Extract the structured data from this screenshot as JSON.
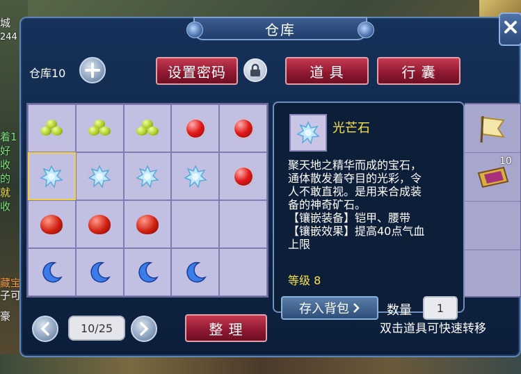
{
  "window": {
    "title": "仓库"
  },
  "warehouse": {
    "label": "仓库10",
    "add_icon": "plus-icon"
  },
  "buttons": {
    "set_password": "设置密码",
    "items_tab": "道 具",
    "bag_tab": "行 囊",
    "sort": "整 理",
    "store_to_bag": "存入背包"
  },
  "grid": {
    "rows": [
      [
        "green-beads",
        "green-beads",
        "green-beads",
        "ruby",
        "ruby"
      ],
      [
        "crystal",
        "crystal",
        "crystal",
        "crystal",
        "ruby"
      ],
      [
        "red-stone",
        "red-stone",
        "red-stone",
        "",
        ""
      ],
      [
        "blue-moon",
        "blue-moon",
        "blue-moon",
        "blue-moon",
        ""
      ]
    ],
    "selected": {
      "row": 1,
      "col": 0
    }
  },
  "tooltip": {
    "name": "光芒石",
    "description_lines": [
      "聚天地之精华而成的宝石，",
      "通体散发着夺目的光彩，令",
      "人不敢直视。是用来合成装",
      "备的神奇矿石。",
      "【镶嵌装备】铠甲、腰带",
      "【镶嵌效果】提高40点气血",
      "上限"
    ],
    "level": "等级 8",
    "quantity_label": "数量",
    "quantity_value": "1"
  },
  "right_panel": {
    "badge": "10"
  },
  "pagination": {
    "value": "10/25"
  },
  "footer_hint": "双击道具可快速转移",
  "background": {
    "left_texts": [
      "城",
      "244",
      "着1",
      "好",
      "收",
      "的",
      "就",
      "收",
      "藏宝",
      "子可",
      "豪"
    ]
  },
  "colors": {
    "title_gold": "#f8e44a",
    "red_button": "#8c1830",
    "grid_bg": "#a7a6cc"
  }
}
